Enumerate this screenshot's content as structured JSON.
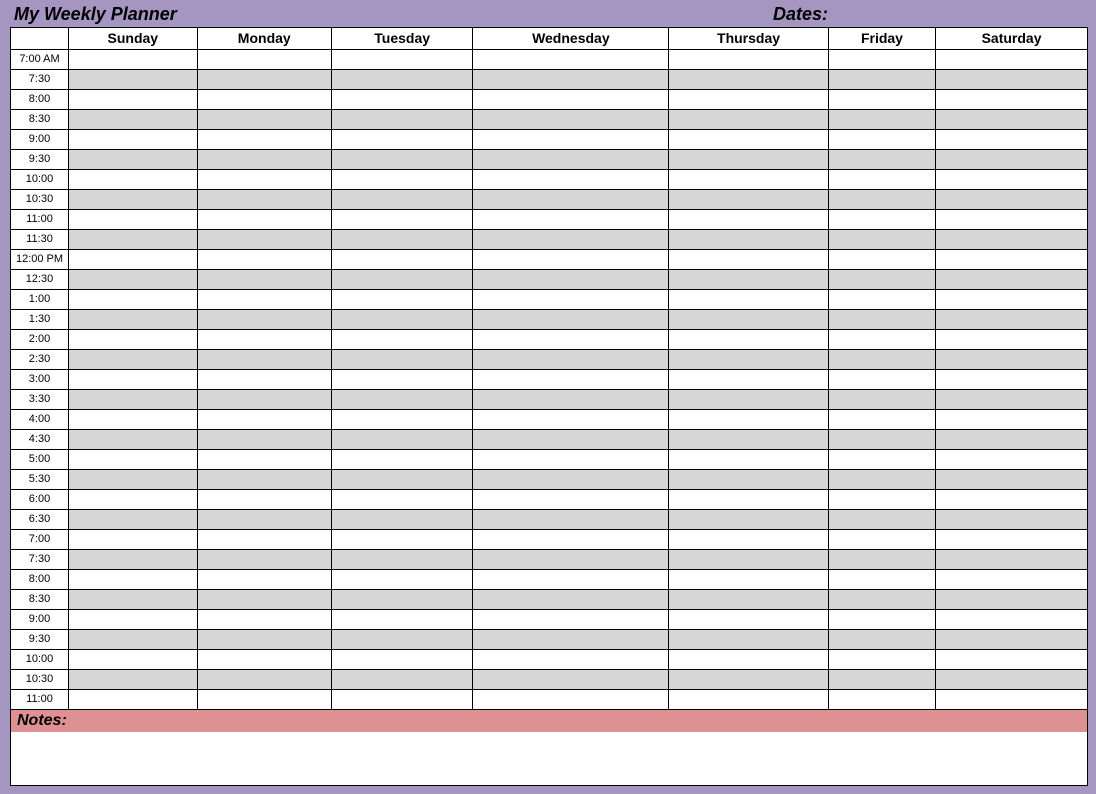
{
  "header": {
    "title": "My Weekly Planner",
    "dates_label": "Dates:"
  },
  "days": [
    "Sunday",
    "Monday",
    "Tuesday",
    "Wednesday",
    "Thursday",
    "Friday",
    "Saturday"
  ],
  "times": [
    "7:00 AM",
    "7:30",
    "8:00",
    "8:30",
    "9:00",
    "9:30",
    "10:00",
    "10:30",
    "11:00",
    "11:30",
    "12:00 PM",
    "12:30",
    "1:00",
    "1:30",
    "2:00",
    "2:30",
    "3:00",
    "3:30",
    "4:00",
    "4:30",
    "5:00",
    "5:30",
    "6:00",
    "6:30",
    "7:00",
    "7:30",
    "8:00",
    "8:30",
    "9:00",
    "9:30",
    "10:00",
    "10:30",
    "11:00"
  ],
  "notes_label": "Notes:"
}
